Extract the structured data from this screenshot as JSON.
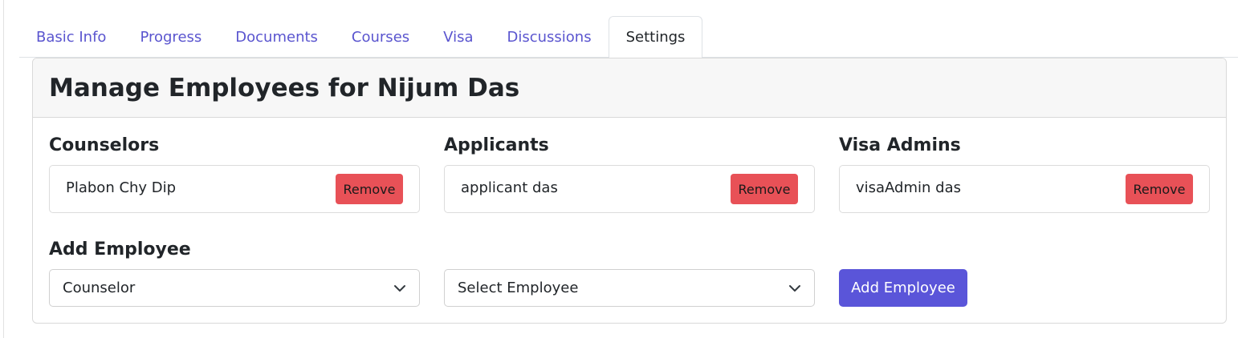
{
  "tabs": [
    {
      "label": "Basic Info"
    },
    {
      "label": "Progress"
    },
    {
      "label": "Documents"
    },
    {
      "label": "Courses"
    },
    {
      "label": "Visa"
    },
    {
      "label": "Discussions"
    },
    {
      "label": "Settings",
      "active": true
    }
  ],
  "card": {
    "title": "Manage Employees for Nijum Das"
  },
  "columns": [
    {
      "title": "Counselors",
      "employee": "Plabon Chy Dip",
      "remove_label": "Remove"
    },
    {
      "title": "Applicants",
      "employee": "applicant das",
      "remove_label": "Remove"
    },
    {
      "title": "Visa Admins",
      "employee": "visaAdmin das",
      "remove_label": "Remove"
    }
  ],
  "add_employee": {
    "heading": "Add Employee",
    "role_select_value": "Counselor",
    "employee_select_value": "Select Employee",
    "button_label": "Add Employee"
  },
  "colors": {
    "accent": "#5a55d9",
    "tab_link": "#5a55cf",
    "danger": "#e85157"
  },
  "icons": {
    "select_arrow": "chevron-down-icon"
  }
}
